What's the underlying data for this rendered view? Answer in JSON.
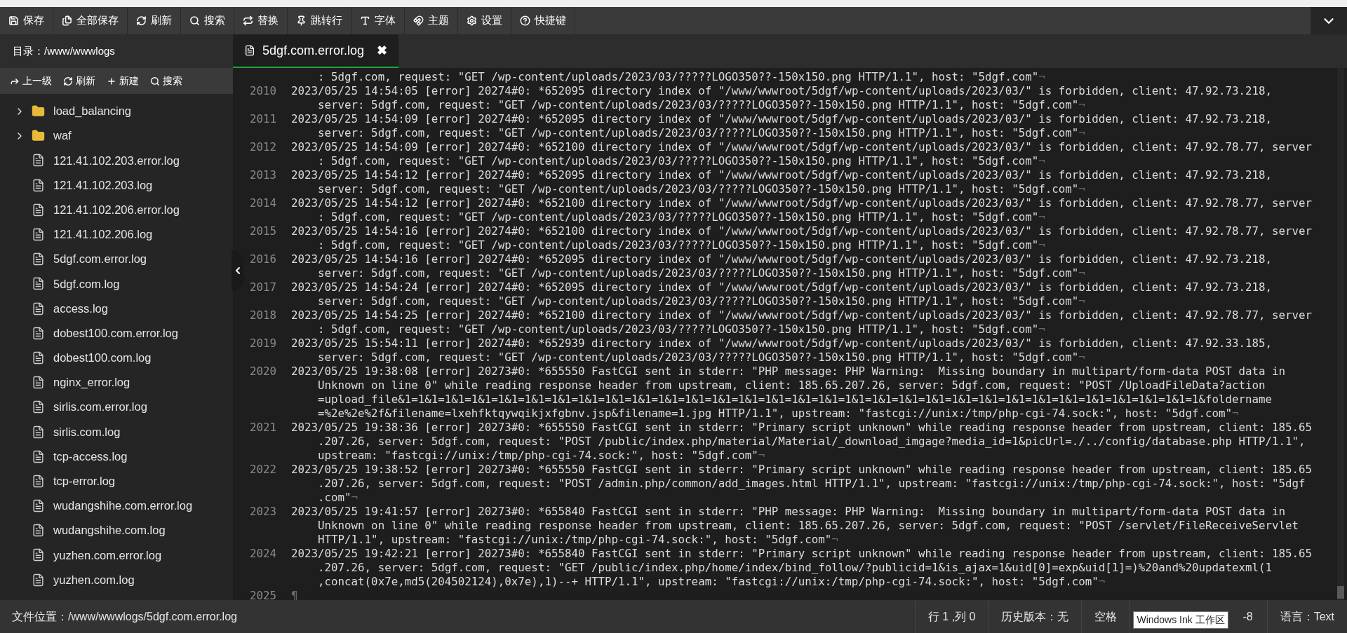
{
  "toolbar": {
    "buttons": [
      {
        "label": "保存"
      },
      {
        "label": "全部保存"
      },
      {
        "label": "刷新"
      },
      {
        "label": "搜索"
      },
      {
        "label": "替换"
      },
      {
        "label": "跳转行"
      },
      {
        "label": "字体"
      },
      {
        "label": "主题"
      },
      {
        "label": "设置"
      },
      {
        "label": "快捷键"
      }
    ]
  },
  "sidebar": {
    "directory": "目录：/www/wwwlogs",
    "actions": [
      {
        "label": "上一级"
      },
      {
        "label": "刷新"
      },
      {
        "label": "新建"
      },
      {
        "label": "搜索"
      }
    ],
    "items": [
      {
        "kind": "folder",
        "name": "load_balancing",
        "expanded": false
      },
      {
        "kind": "folder",
        "name": "waf",
        "expanded": false
      },
      {
        "kind": "file",
        "name": "121.41.102.203.error.log"
      },
      {
        "kind": "file",
        "name": "121.41.102.203.log"
      },
      {
        "kind": "file",
        "name": "121.41.102.206.error.log"
      },
      {
        "kind": "file",
        "name": "121.41.102.206.log"
      },
      {
        "kind": "file",
        "name": "5dgf.com.error.log"
      },
      {
        "kind": "file",
        "name": "5dgf.com.log"
      },
      {
        "kind": "file",
        "name": "access.log"
      },
      {
        "kind": "file",
        "name": "dobest100.com.error.log"
      },
      {
        "kind": "file",
        "name": "dobest100.com.log"
      },
      {
        "kind": "file",
        "name": "nginx_error.log"
      },
      {
        "kind": "file",
        "name": "sirlis.com.error.log"
      },
      {
        "kind": "file",
        "name": "sirlis.com.log"
      },
      {
        "kind": "file",
        "name": "tcp-access.log"
      },
      {
        "kind": "file",
        "name": "tcp-error.log"
      },
      {
        "kind": "file",
        "name": "wudangshihe.com.error.log"
      },
      {
        "kind": "file",
        "name": "wudangshihe.com.log"
      },
      {
        "kind": "file",
        "name": "yuzhen.com.error.log"
      },
      {
        "kind": "file",
        "name": "yuzhen.com.log"
      }
    ]
  },
  "tabs": [
    {
      "label": "5dgf.com.error.log",
      "selected": true,
      "close": "✖"
    }
  ],
  "editor": {
    "lines": [
      {
        "rows": [
          ": 5dgf.com, request: \"GET /wp-content/uploads/2023/03/?????LOGO350??-150x150.png HTTP/1.1\", host: \"5dgf.com\""
        ],
        "eol": "¬"
      },
      {
        "number": "2010",
        "rows": [
          "2023/05/25 14:54:05 [error] 20274#0: *652095 directory index of \"/www/wwwroot/5dgf/wp-content/uploads/2023/03/\" is forbidden, client: 47.92.73.218,",
          "server: 5dgf.com, request: \"GET /wp-content/uploads/2023/03/?????LOGO350??-150x150.png HTTP/1.1\", host: \"5dgf.com\""
        ],
        "eol": "¬"
      },
      {
        "number": "2011",
        "rows": [
          "2023/05/25 14:54:09 [error] 20274#0: *652095 directory index of \"/www/wwwroot/5dgf/wp-content/uploads/2023/03/\" is forbidden, client: 47.92.73.218,",
          "server: 5dgf.com, request: \"GET /wp-content/uploads/2023/03/?????LOGO350??-150x150.png HTTP/1.1\", host: \"5dgf.com\""
        ],
        "eol": "¬"
      },
      {
        "number": "2012",
        "rows": [
          "2023/05/25 14:54:09 [error] 20274#0: *652100 directory index of \"/www/wwwroot/5dgf/wp-content/uploads/2023/03/\" is forbidden, client: 47.92.78.77, server",
          ": 5dgf.com, request: \"GET /wp-content/uploads/2023/03/?????LOGO350??-150x150.png HTTP/1.1\", host: \"5dgf.com\""
        ],
        "eol": "¬"
      },
      {
        "number": "2013",
        "rows": [
          "2023/05/25 14:54:12 [error] 20274#0: *652095 directory index of \"/www/wwwroot/5dgf/wp-content/uploads/2023/03/\" is forbidden, client: 47.92.73.218,",
          "server: 5dgf.com, request: \"GET /wp-content/uploads/2023/03/?????LOGO350??-150x150.png HTTP/1.1\", host: \"5dgf.com\""
        ],
        "eol": "¬"
      },
      {
        "number": "2014",
        "rows": [
          "2023/05/25 14:54:12 [error] 20274#0: *652100 directory index of \"/www/wwwroot/5dgf/wp-content/uploads/2023/03/\" is forbidden, client: 47.92.78.77, server",
          ": 5dgf.com, request: \"GET /wp-content/uploads/2023/03/?????LOGO350??-150x150.png HTTP/1.1\", host: \"5dgf.com\""
        ],
        "eol": "¬"
      },
      {
        "number": "2015",
        "rows": [
          "2023/05/25 14:54:16 [error] 20274#0: *652100 directory index of \"/www/wwwroot/5dgf/wp-content/uploads/2023/03/\" is forbidden, client: 47.92.78.77, server",
          ": 5dgf.com, request: \"GET /wp-content/uploads/2023/03/?????LOGO350??-150x150.png HTTP/1.1\", host: \"5dgf.com\""
        ],
        "eol": "¬"
      },
      {
        "number": "2016",
        "rows": [
          "2023/05/25 14:54:16 [error] 20274#0: *652095 directory index of \"/www/wwwroot/5dgf/wp-content/uploads/2023/03/\" is forbidden, client: 47.92.73.218,",
          "server: 5dgf.com, request: \"GET /wp-content/uploads/2023/03/?????LOGO350??-150x150.png HTTP/1.1\", host: \"5dgf.com\""
        ],
        "eol": "¬"
      },
      {
        "number": "2017",
        "rows": [
          "2023/05/25 14:54:24 [error] 20274#0: *652095 directory index of \"/www/wwwroot/5dgf/wp-content/uploads/2023/03/\" is forbidden, client: 47.92.73.218,",
          "server: 5dgf.com, request: \"GET /wp-content/uploads/2023/03/?????LOGO350??-150x150.png HTTP/1.1\", host: \"5dgf.com\""
        ],
        "eol": "¬"
      },
      {
        "number": "2018",
        "rows": [
          "2023/05/25 14:54:25 [error] 20274#0: *652100 directory index of \"/www/wwwroot/5dgf/wp-content/uploads/2023/03/\" is forbidden, client: 47.92.78.77, server",
          ": 5dgf.com, request: \"GET /wp-content/uploads/2023/03/?????LOGO350??-150x150.png HTTP/1.1\", host: \"5dgf.com\""
        ],
        "eol": "¬"
      },
      {
        "number": "2019",
        "rows": [
          "2023/05/25 15:54:11 [error] 20274#0: *652939 directory index of \"/www/wwwroot/5dgf/wp-content/uploads/2023/03/\" is forbidden, client: 47.92.33.185,",
          "server: 5dgf.com, request: \"GET /wp-content/uploads/2023/03/?????LOGO350??-150x150.png HTTP/1.1\", host: \"5dgf.com\""
        ],
        "eol": "¬"
      },
      {
        "number": "2020",
        "rows": [
          "2023/05/25 19:38:08 [error] 20273#0: *655550 FastCGI sent in stderr: \"PHP message: PHP Warning:  Missing boundary in multipart/form-data POST data in",
          "Unknown on line 0\" while reading response header from upstream, client: 185.65.207.26, server: 5dgf.com, request: \"POST /UploadFileData?action",
          "=upload_file&1=1&1=1&1=1&1=1&1=1&1=1&1=1&1=1&1=1&1=1&1=1&1=1&1=1&1=1&1=1&1=1&1=1&1=1&1=1&1=1&1=1&1=1&1=1&1=1&1=1&1=1&1=1&1=1&1=1&1=1&foldername",
          "=%2e%2e%2f&filename=lxehfktqywqikjxfgbnv.jsp&filename=1.jpg HTTP/1.1\", upstream: \"fastcgi://unix:/tmp/php-cgi-74.sock:\", host: \"5dgf.com\""
        ],
        "eol": "¬"
      },
      {
        "number": "2021",
        "rows": [
          "2023/05/25 19:38:36 [error] 20273#0: *655550 FastCGI sent in stderr: \"Primary script unknown\" while reading response header from upstream, client: 185.65",
          ".207.26, server: 5dgf.com, request: \"POST /public/index.php/material/Material/_download_imgage?media_id=1&picUrl=./../config/database.php HTTP/1.1\",",
          "upstream: \"fastcgi://unix:/tmp/php-cgi-74.sock:\", host: \"5dgf.com\""
        ],
        "eol": "¬"
      },
      {
        "number": "2022",
        "rows": [
          "2023/05/25 19:38:52 [error] 20273#0: *655550 FastCGI sent in stderr: \"Primary script unknown\" while reading response header from upstream, client: 185.65",
          ".207.26, server: 5dgf.com, request: \"POST /admin.php/common/add_images.html HTTP/1.1\", upstream: \"fastcgi://unix:/tmp/php-cgi-74.sock:\", host: \"5dgf",
          ".com\""
        ],
        "eol": "¬"
      },
      {
        "number": "2023",
        "rows": [
          "2023/05/25 19:41:57 [error] 20273#0: *655840 FastCGI sent in stderr: \"PHP message: PHP Warning:  Missing boundary in multipart/form-data POST data in",
          "Unknown on line 0\" while reading response header from upstream, client: 185.65.207.26, server: 5dgf.com, request: \"POST /servlet/FileReceiveServlet",
          "HTTP/1.1\", upstream: \"fastcgi://unix:/tmp/php-cgi-74.sock:\", host: \"5dgf.com\""
        ],
        "eol": "¬"
      },
      {
        "number": "2024",
        "rows": [
          "2023/05/25 19:42:21 [error] 20273#0: *655840 FastCGI sent in stderr: \"Primary script unknown\" while reading response header from upstream, client: 185.65",
          ".207.26, server: 5dgf.com, request: \"GET /public/index.php/home/index/bind_follow/?publicid=1&is_ajax=1&uid[0]=exp&uid[1]=)%20and%20updatexml(1",
          ",concat(0x7e,md5(204502124),0x7e),1)--+ HTTP/1.1\", upstream: \"fastcgi://unix:/tmp/php-cgi-74.sock:\", host: \"5dgf.com\""
        ],
        "eol": "¬"
      },
      {
        "number": "2025",
        "rows": [
          ""
        ],
        "eol": "¶"
      }
    ]
  },
  "status_bar": {
    "file_location": "文件位置：/www/wwwlogs/5dgf.com.error.log",
    "items": [
      {
        "text": "行 1 ,列 0"
      },
      {
        "text": "历史版本：无"
      },
      {
        "text": "空格"
      },
      {
        "text": "-8",
        "tooltip": "Windows Ink 工作区"
      },
      {
        "text": "语言：Text"
      }
    ]
  }
}
